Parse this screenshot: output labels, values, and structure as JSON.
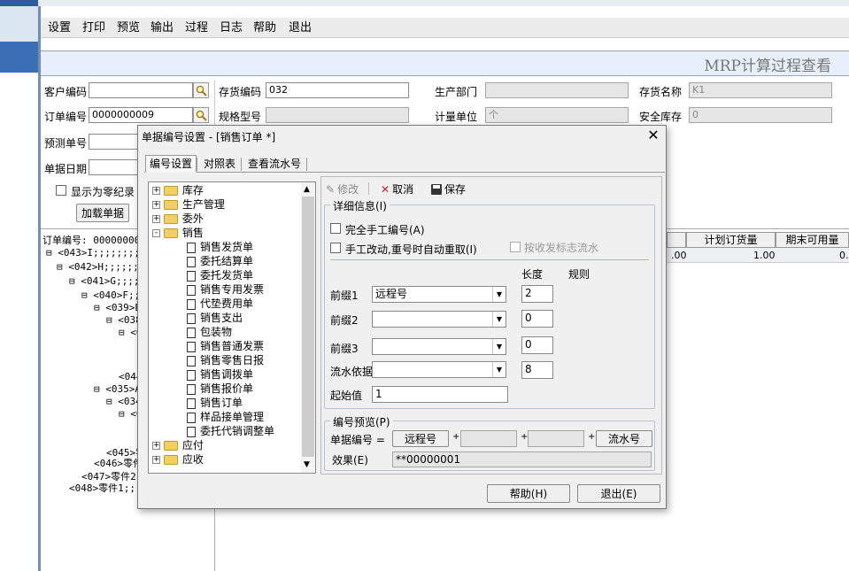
{
  "menu": [
    "设置",
    "打印",
    "预览",
    "输出",
    "过程",
    "日志",
    "帮助",
    "退出"
  ],
  "banner_title": "MRP计算过程查看",
  "form": {
    "customer_code_label": "客户编码",
    "customer_code_value": "",
    "order_no_label": "订单编号",
    "order_no_value": "0000000009",
    "forecast_no_label": "预测单号",
    "doc_date_label": "单据日期",
    "show_zero_label": "显示为零纪录",
    "load_button": "加载单据",
    "inventory_code_label": "存货编码",
    "inventory_code_value": "032",
    "spec_label": "规格型号",
    "dept_label": "生产部门",
    "unit_label": "计量单位",
    "unit_value": "个",
    "inv_name_label": "存货名称",
    "inv_name_value": "K1",
    "safety_stock_label": "安全库存",
    "safety_stock_value": "0"
  },
  "left_tree": {
    "root": "订单编号: 0000000009",
    "lines": [
      "⊟ <043>I;;;;;;;;;",
      "⊟ <042>H;;;;;;;;",
      "⊟ <041>G;;;;;;;;",
      "⊟ <040>F;;;;;;;;",
      "⊟ <039>E",
      "⊟ <038",
      "⊟ <0",
      "",
      "",
      "<044",
      "⊟ <035>A",
      "⊟ <034",
      "⊟ <0",
      "",
      "",
      "<045>零",
      "<046>零件",
      "<047>零件2;",
      "<048>零件1;;;"
    ]
  },
  "grid": {
    "headers": [
      "计划订货量",
      "期末可用量"
    ],
    "values": [
      ".00",
      "1.00",
      "0."
    ]
  },
  "dialog": {
    "title": "单据编号设置 - [销售订单 *]",
    "tabs": [
      "编号设置",
      "对照表",
      "查看流水号"
    ],
    "toolbar": {
      "edit": "修改",
      "cancel": "取消",
      "save": "保存"
    },
    "tree": [
      {
        "level": 0,
        "type": "folder",
        "sign": "+",
        "label": "库存"
      },
      {
        "level": 0,
        "type": "folder",
        "sign": "+",
        "label": "生产管理"
      },
      {
        "level": 0,
        "type": "folder",
        "sign": "+",
        "label": "委外"
      },
      {
        "level": 0,
        "type": "folder",
        "sign": "-",
        "label": "销售"
      },
      {
        "level": 1,
        "type": "doc",
        "label": "销售发货单"
      },
      {
        "level": 1,
        "type": "doc",
        "label": "委托结算单"
      },
      {
        "level": 1,
        "type": "doc",
        "label": "委托发货单"
      },
      {
        "level": 1,
        "type": "doc",
        "label": "销售专用发票"
      },
      {
        "level": 1,
        "type": "doc",
        "label": "代垫费用单"
      },
      {
        "level": 1,
        "type": "doc",
        "label": "销售支出"
      },
      {
        "level": 1,
        "type": "doc",
        "label": "包装物"
      },
      {
        "level": 1,
        "type": "doc",
        "label": "销售普通发票"
      },
      {
        "level": 1,
        "type": "doc",
        "label": "销售零售日报"
      },
      {
        "level": 1,
        "type": "doc",
        "label": "销售调拨单"
      },
      {
        "level": 1,
        "type": "doc",
        "label": "销售报价单"
      },
      {
        "level": 1,
        "type": "doc",
        "label": "销售订单"
      },
      {
        "level": 1,
        "type": "doc",
        "label": "样品接单管理"
      },
      {
        "level": 1,
        "type": "doc",
        "label": "委托代销调整单"
      },
      {
        "level": 0,
        "type": "folder",
        "sign": "+",
        "label": "应付"
      },
      {
        "level": 0,
        "type": "folder",
        "sign": "+",
        "label": "应收"
      }
    ],
    "detail": {
      "legend": "详细信息(I)",
      "manual_all": "完全手工编号(A)",
      "manual_modify": "手工改动,重号时自动重取(I)",
      "by_receipt": "按收发标志流水",
      "length_header": "长度",
      "rule_header": "规则",
      "prefix1_label": "前缀1",
      "prefix1_value": "远程号",
      "prefix1_len": "2",
      "prefix2_label": "前缀2",
      "prefix2_value": "",
      "prefix2_len": "0",
      "prefix3_label": "前缀3",
      "prefix3_value": "",
      "prefix3_len": "0",
      "serial_label": "流水依据",
      "serial_value": "",
      "serial_len": "8",
      "start_label": "起始值",
      "start_value": "1"
    },
    "preview": {
      "legend": "编号预览(P)",
      "doc_no_label": "单据编号 =",
      "part1": "远程号",
      "part2": "",
      "part3": "",
      "part4": "流水号",
      "effect_label": "效果(E)",
      "effect_value": "**00000001"
    },
    "help_button": "帮助(H)",
    "exit_button": "退出(E)"
  }
}
